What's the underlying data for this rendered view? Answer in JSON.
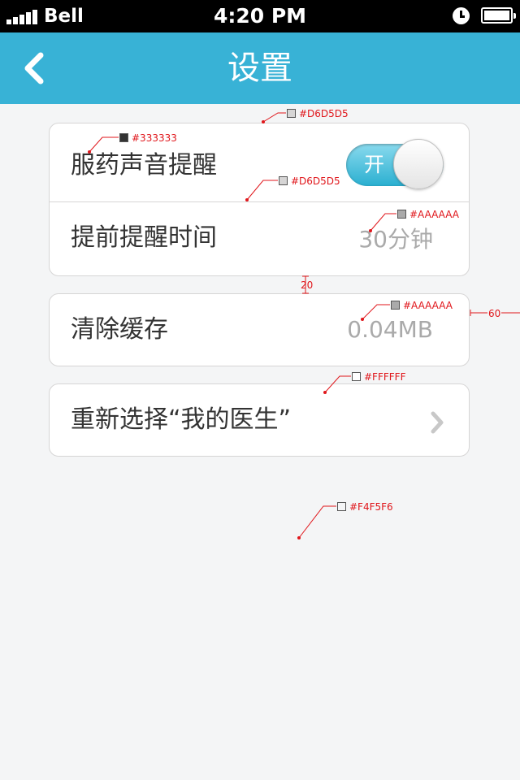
{
  "status_bar": {
    "carrier": "Bell",
    "time": "4:20 PM"
  },
  "nav": {
    "title": "设置",
    "back_icon": "chevron-left-icon"
  },
  "settings": {
    "medication_sound": {
      "label": "服药声音提醒",
      "toggle_label": "开",
      "toggle_on": true
    },
    "advance_reminder": {
      "label": "提前提醒时间",
      "value": "30分钟"
    },
    "clear_cache": {
      "label": "清除缓存",
      "value": "0.04MB"
    },
    "reselect_doctor": {
      "label": "重新选择“我的医生”",
      "icon": "chevron-right-icon"
    }
  },
  "annotations": {
    "divider_color_top": "#D6D5D5",
    "label_color": "#333333",
    "divider_color_mid": "#D6D5D5",
    "value_color_1": "#AAAAAA",
    "spacing": "20",
    "value_color_2": "#AAAAAA",
    "margin": "60",
    "card_color": "#FFFFFF",
    "background_color": "#F4F5F6"
  },
  "colors": {
    "nav_bar": "#38B2D6",
    "text": "#333333",
    "value_text": "#AAAAAA",
    "border": "#D6D5D5",
    "card": "#FFFFFF",
    "background": "#F4F5F6",
    "annotation": "#E0161B"
  }
}
